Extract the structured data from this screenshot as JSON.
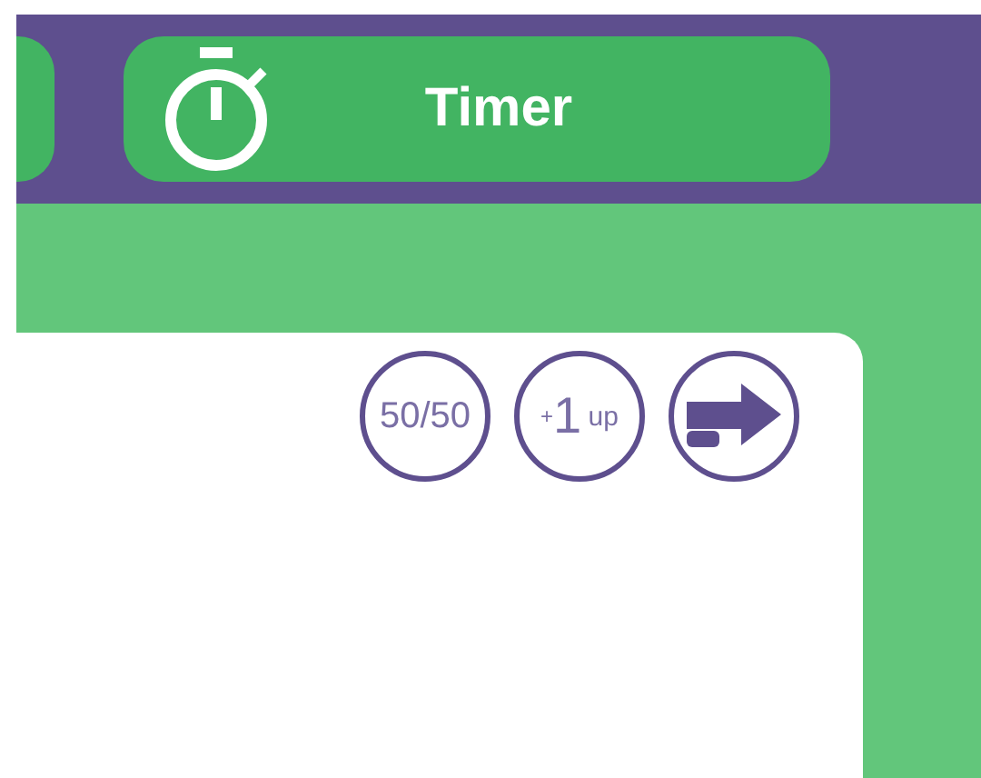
{
  "timer": {
    "label": "Timer"
  },
  "lifelines": [
    {
      "kind": "fifty_fifty",
      "parts": [
        "50/50"
      ]
    },
    {
      "kind": "extra_life",
      "parts": [
        "+",
        "1",
        "up"
      ]
    },
    {
      "kind": "skip"
    }
  ]
}
